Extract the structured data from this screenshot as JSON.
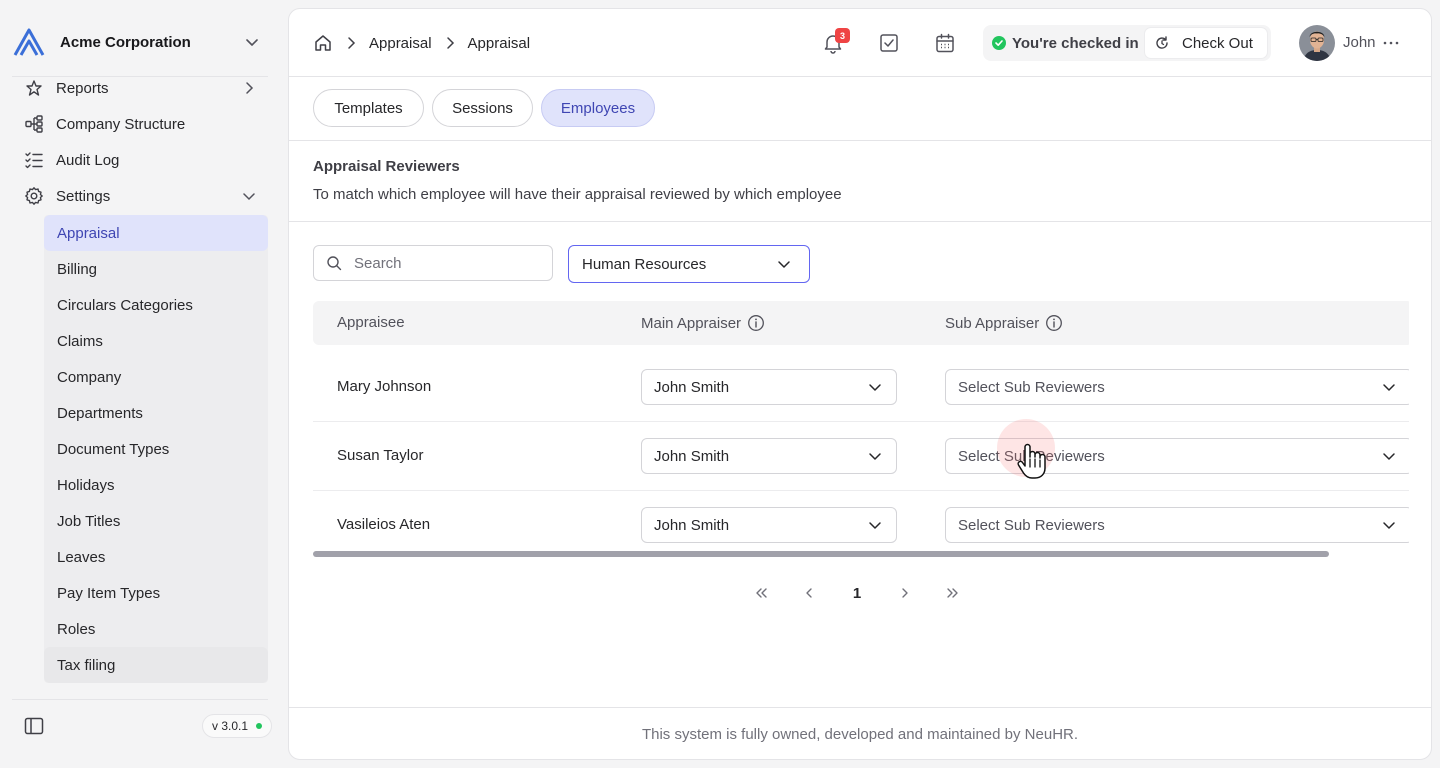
{
  "org": {
    "name": "Acme Corporation"
  },
  "sidebar": {
    "partial_item": "Reports",
    "items": [
      {
        "label": "Company Structure",
        "icon": "hierarchy-icon"
      },
      {
        "label": "Audit Log",
        "icon": "list-checks-icon"
      },
      {
        "label": "Settings",
        "icon": "gear-icon",
        "expanded": true
      }
    ],
    "settings_items": [
      "Appraisal",
      "Billing",
      "Circulars Categories",
      "Claims",
      "Company",
      "Departments",
      "Document Types",
      "Holidays",
      "Job Titles",
      "Leaves",
      "Pay Item Types",
      "Roles",
      "Tax filing"
    ],
    "active_item": "Appraisal",
    "hover_item": "Tax filing",
    "version": "v 3.0.1"
  },
  "header": {
    "breadcrumb": [
      "Appraisal",
      "Appraisal"
    ],
    "notifications_count": "3",
    "checked_in_text": "You're checked in",
    "checkout_label": "Check Out",
    "user_name": "John"
  },
  "tabs": [
    {
      "label": "Templates",
      "active": false
    },
    {
      "label": "Sessions",
      "active": false
    },
    {
      "label": "Employees",
      "active": true
    }
  ],
  "section": {
    "title": "Appraisal Reviewers",
    "description": "To match which employee will have their appraisal reviewed by which employee"
  },
  "filters": {
    "search_placeholder": "Search",
    "department": "Human Resources"
  },
  "table": {
    "columns": [
      "Appraisee",
      "Main Appraiser",
      "Sub Appraiser"
    ],
    "rows": [
      {
        "appraisee": "Mary Johnson",
        "main_appraiser": "John Smith",
        "sub_appraiser": "Select Sub Reviewers"
      },
      {
        "appraisee": "Susan Taylor",
        "main_appraiser": "John Smith",
        "sub_appraiser": "Select Sub Reviewers"
      },
      {
        "appraisee": "Vasileios Aten",
        "main_appraiser": "John Smith",
        "sub_appraiser": "Select Sub Reviewers"
      }
    ]
  },
  "pagination": {
    "current_page": "1"
  },
  "footer": {
    "text": "This system is fully owned, developed and maintained by NeuHR."
  },
  "colors": {
    "accent": "#6366f1",
    "active_bg": "#e0e3fb",
    "active_text": "#3f46b3",
    "success": "#22c55e",
    "badge": "#ef4444"
  }
}
